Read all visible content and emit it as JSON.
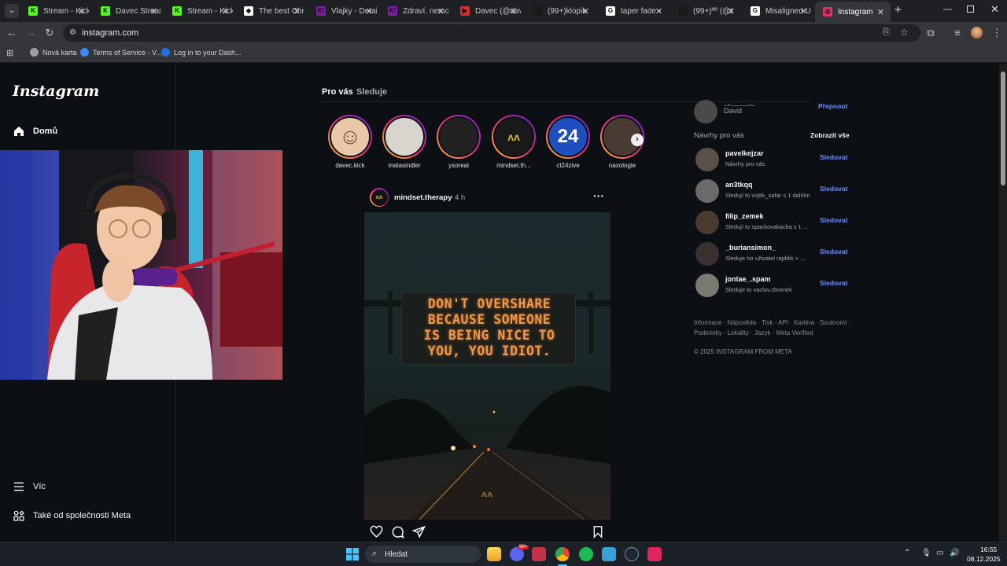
{
  "browser": {
    "tabs": [
      {
        "label": "Stream - Kick",
        "fav_color": "#53fc18",
        "fav_glyph": "K"
      },
      {
        "label": "Davec Stream",
        "fav_color": "#53fc18",
        "fav_glyph": "K"
      },
      {
        "label": "Stream - Kick",
        "fav_color": "#53fc18",
        "fav_glyph": "K"
      },
      {
        "label": "The best Chro",
        "fav_color": "#ffffff",
        "fav_glyph": "◆"
      },
      {
        "label": "Vlajky - Detai",
        "fav_color": "#7b1fa2",
        "fav_glyph": "K!"
      },
      {
        "label": "Zdraví, nemoc",
        "fav_color": "#7b1fa2",
        "fav_glyph": "K!"
      },
      {
        "label": "Davec (@dav",
        "fav_color": "#d32f2f",
        "fav_glyph": "▶"
      },
      {
        "label": "(99+)klopik",
        "fav_color": "#1a1a1a",
        "fav_glyph": "♪"
      },
      {
        "label": "taper fade -",
        "fav_color": "#ffffff",
        "fav_glyph": "G"
      },
      {
        "label": "(99+)ºº (@t",
        "fav_color": "#1a1a1a",
        "fav_glyph": "♪"
      },
      {
        "label": "Misaligned U",
        "fav_color": "#ffffff",
        "fav_glyph": "G"
      },
      {
        "label": "Instagram",
        "fav_color": "#e1306c",
        "fav_glyph": "◎"
      }
    ],
    "url": "instagram.com",
    "bookmarks": [
      {
        "label": "Nová karta",
        "icon": "globe-icon",
        "color": "#9aa0a6"
      },
      {
        "label": "Terms of Service - V...",
        "icon": "v-logo-icon",
        "color": "#4285f4"
      },
      {
        "label": "Log in to your Dash...",
        "icon": "a-logo-icon",
        "color": "#1a73e8"
      }
    ]
  },
  "nav": {
    "logo": "Instagram",
    "home": "Domů",
    "more": "Víc",
    "meta": "Také od společnosti Meta"
  },
  "feed": {
    "tab_foryou": "Pro vás",
    "tab_following": "Sleduje",
    "stories": [
      {
        "name": "davec.kick",
        "color": "#e8c8a8",
        "glyph": "☺"
      },
      {
        "name": "matasindler",
        "color": "#d8d4ce",
        "glyph": ""
      },
      {
        "name": "ysoreal",
        "color": "#222222",
        "glyph": ""
      },
      {
        "name": "mindset.th...",
        "color": "#1a1a1a",
        "glyph": "ʌʌ"
      },
      {
        "name": "ct24zive",
        "color": "#1f4fbf",
        "glyph": "24"
      },
      {
        "name": "naxologie",
        "color": "#4a3a34",
        "glyph": ""
      }
    ],
    "post": {
      "author": "mindset.therapy",
      "time": "• 4 h",
      "sign_lines": [
        "DON'T OVERSHARE",
        "BECAUSE SOMEONE",
        "IS BEING NICE TO",
        "YOU, YOU IDIOT."
      ]
    }
  },
  "sidebar_right": {
    "account_name": "David",
    "account_handle": "_._____._",
    "switch": "Přepnout",
    "suggestions_title": "Návrhy pro vás",
    "see_all": "Zobrazit vše",
    "suggestions": [
      {
        "username": "pavelkejzar",
        "sub": "Návrhy pro vás",
        "follow": "Sledovat",
        "color": "#5a5048"
      },
      {
        "username": "an3tkqq",
        "sub": "Sledují to vojtik_safar s 1 dalším",
        "follow": "Sledovat",
        "color": "#6a6a6a"
      },
      {
        "username": "filip_zemek",
        "sub": "Sledují to spackovakacka s 1 ...",
        "follow": "Sledovat",
        "color": "#4a3a30"
      },
      {
        "username": "_buriansimon_",
        "sub": "Sleduje ho uživatel rajdikk + ...",
        "follow": "Sledovat",
        "color": "#3a3030"
      },
      {
        "username": "jontae_.spam",
        "sub": "Sleduje to vaclav.zbranek",
        "follow": "Sledovat",
        "color": "#7a7a70"
      }
    ],
    "footer_line1": "Informace · Nápověda · Tisk · API · Kariéra · Soukromí ·",
    "footer_line2": "Podmínky · Lokality · Jazyk · Meta Verified",
    "copyright": "© 2025 INSTAGRAM FROM META"
  },
  "taskbar": {
    "search": "Hledat",
    "time": "16:55",
    "date": "08.12.2025",
    "discord_badge": "99+"
  }
}
